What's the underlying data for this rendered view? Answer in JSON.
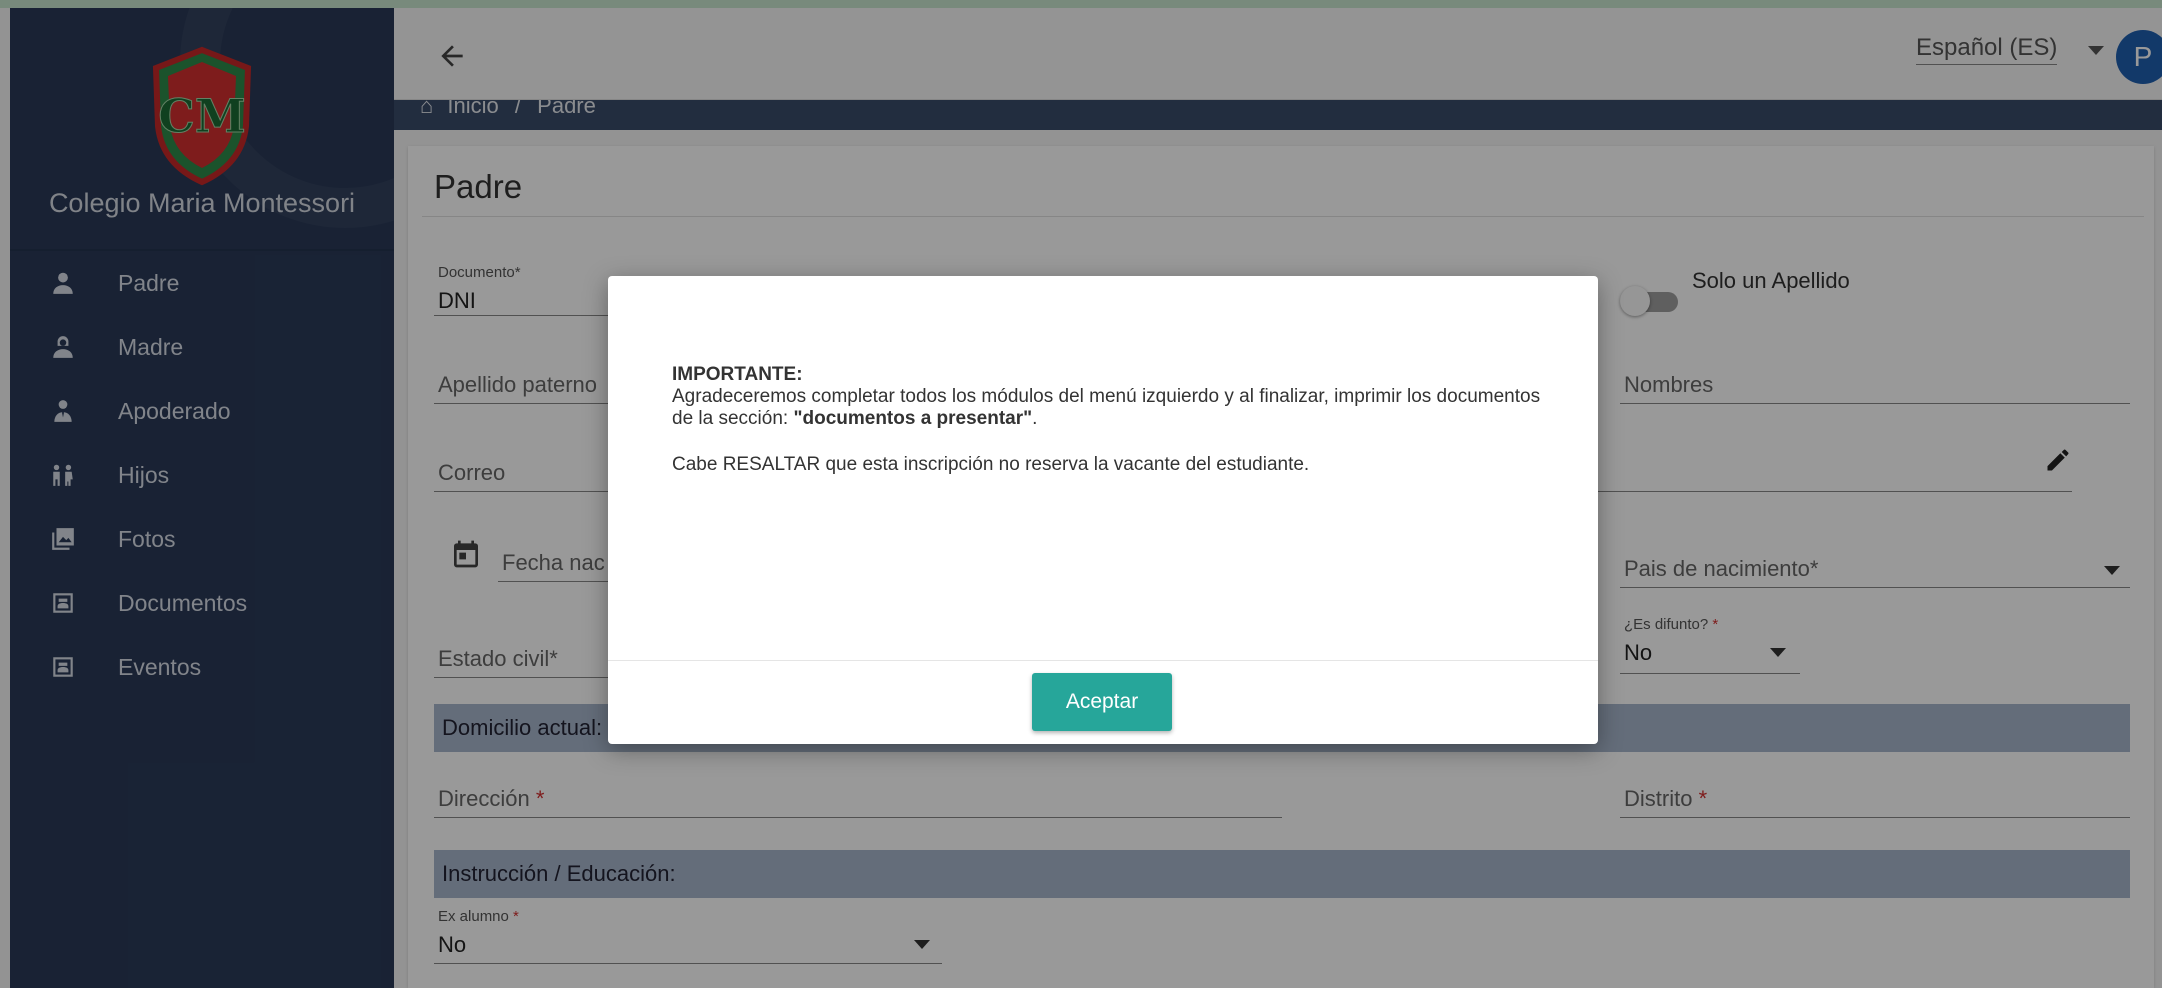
{
  "school": {
    "name": "Colegio Maria Montessori",
    "logo_text": "CM"
  },
  "sidebar": {
    "items": [
      {
        "label": "Padre",
        "icon": "person-icon"
      },
      {
        "label": "Madre",
        "icon": "person-female-icon"
      },
      {
        "label": "Apoderado",
        "icon": "guardian-icon"
      },
      {
        "label": "Hijos",
        "icon": "children-icon"
      },
      {
        "label": "Fotos",
        "icon": "photo-library-icon"
      },
      {
        "label": "Documentos",
        "icon": "document-icon"
      },
      {
        "label": "Eventos",
        "icon": "event-icon"
      }
    ]
  },
  "topbar": {
    "language": "Español (ES)",
    "avatar_initial": "P"
  },
  "breadcrumb": {
    "home": "Inicio",
    "separator": "/",
    "current": "Padre"
  },
  "form": {
    "title": "Padre",
    "documento": {
      "label": "Documento*",
      "value": "DNI"
    },
    "solo_apellido": {
      "label": "Solo un Apellido"
    },
    "apellido_paterno": {
      "label": "Apellido paterno"
    },
    "nombres": {
      "label": "Nombres"
    },
    "correo": {
      "label": "Correo"
    },
    "fecha_nacimiento": {
      "label": "Fecha nac"
    },
    "pais_nacimiento": {
      "label": "Pais de nacimiento*"
    },
    "es_difunto": {
      "label": "¿Es difunto?",
      "req": "*",
      "value": "No"
    },
    "estado_civil": {
      "label": "Estado civil*"
    },
    "domicilio_section": "Domicilio actual:",
    "direccion": {
      "label": "Dirección",
      "req": "*"
    },
    "distrito": {
      "label": "Distrito",
      "req": "*"
    },
    "instruccion_section": "Instrucción / Educación:",
    "ex_alumno": {
      "label": "Ex alumno",
      "req": "*",
      "value": "No"
    }
  },
  "modal": {
    "title": "IMPORTANTE:",
    "line1_prefix": "Agradeceremos completar todos los módulos del menú izquierdo y al finalizar, imprimir los documentos de la sección: ",
    "line1_bold": "\"documentos a presentar\"",
    "line1_suffix": ".",
    "line2": "Cabe RESALTAR que esta inscripción no reserva la vacante del estudiante.",
    "accept_label": "Aceptar"
  },
  "colors": {
    "sidebar": "#2a3a58",
    "accent": "#26a69a",
    "avatar": "#1f5fb0",
    "section": "#a7b6cc"
  }
}
